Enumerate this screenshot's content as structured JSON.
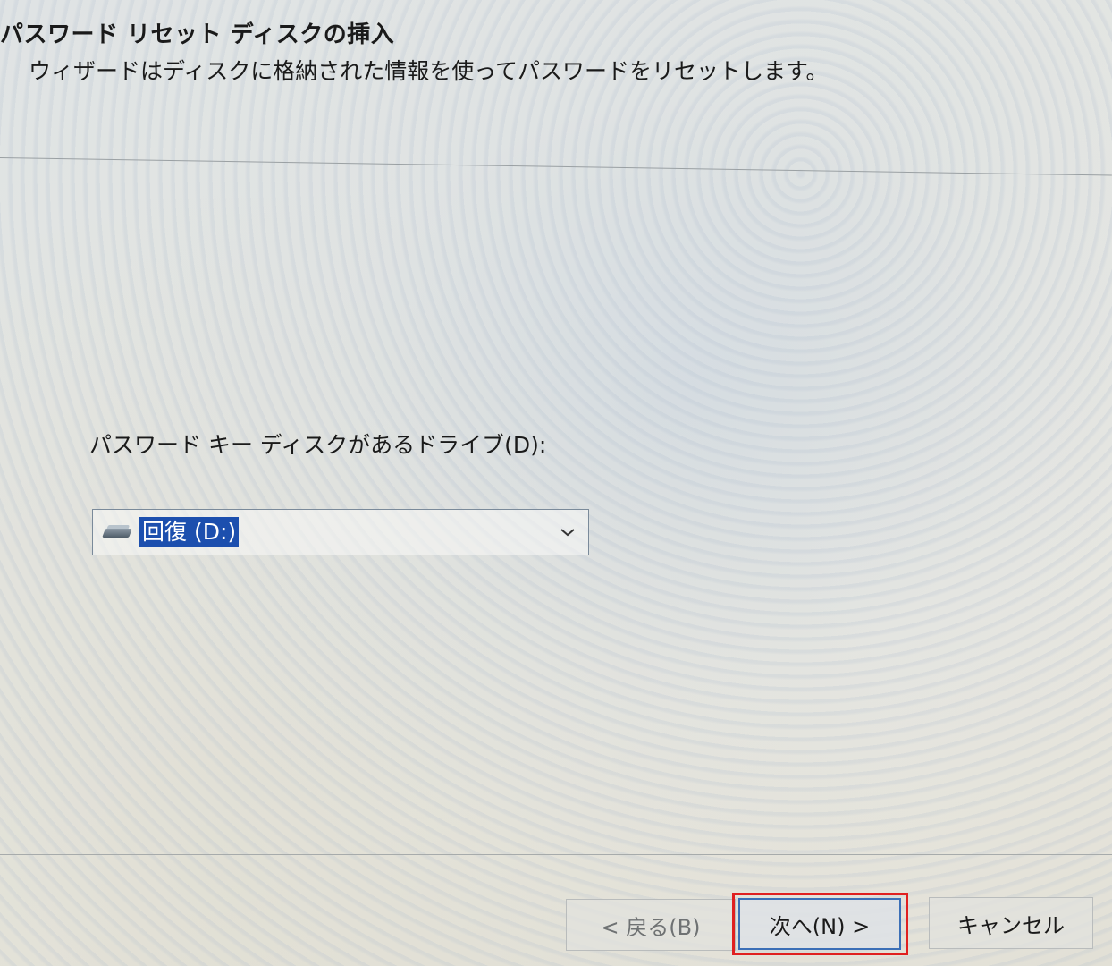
{
  "header": {
    "title": "パスワード リセット ディスクの挿入",
    "subtitle": "ウィザードはディスクに格納された情報を使ってパスワードをリセットします。"
  },
  "drive": {
    "label": "パスワード キー ディスクがあるドライブ(D):",
    "selected_value": "回復 (D:)",
    "icon": "drive-icon"
  },
  "buttons": {
    "back_label": "< 戻る(B)",
    "next_label": "次へ(N) >",
    "cancel_label": "キャンセル"
  },
  "colors": {
    "selection": "#1c4fae",
    "highlight_box": "#e02020",
    "default_button_border": "#3b6fb7"
  }
}
